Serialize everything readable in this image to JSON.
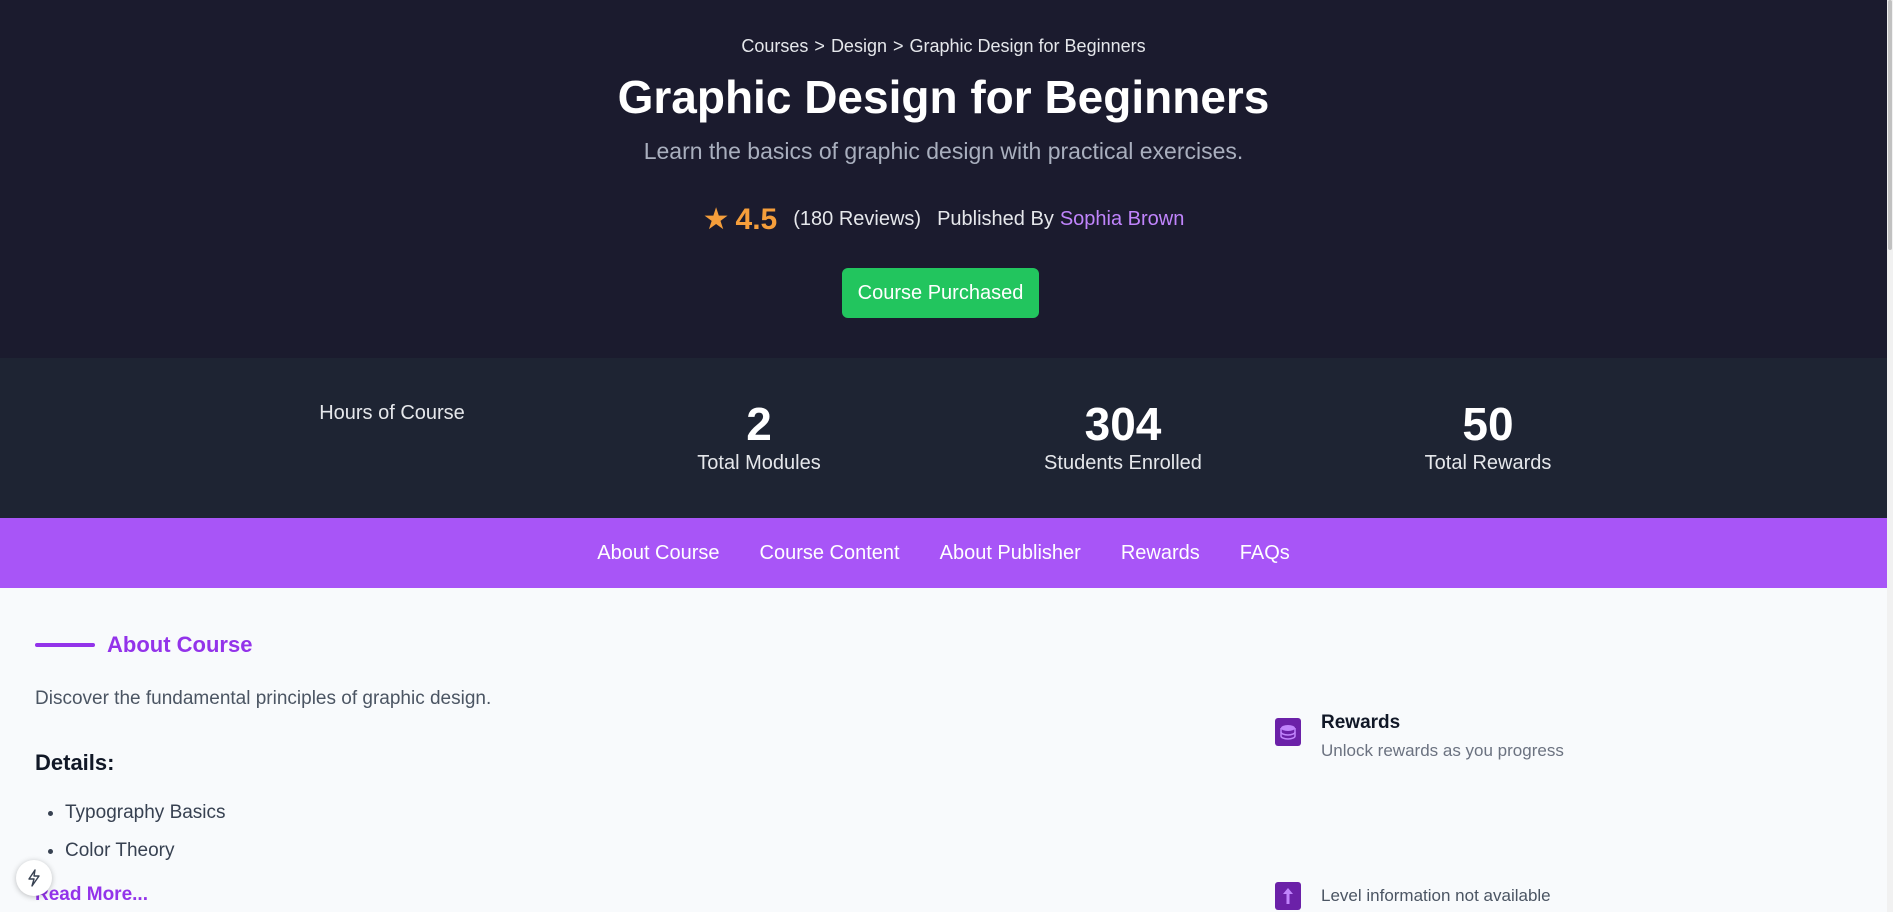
{
  "breadcrumb": {
    "items": [
      "Courses",
      "Design",
      "Graphic Design for Beginners"
    ],
    "separator": ">"
  },
  "course": {
    "title": "Graphic Design for Beginners",
    "subtitle": "Learn the basics of graphic design with practical exercises.",
    "rating": "4.5",
    "reviews": "(180 Reviews)",
    "published_by_label": "Published By",
    "author": "Sophia Brown",
    "status_button": "Course Purchased"
  },
  "stats": {
    "hours_label": "Hours of Course",
    "modules": {
      "value": "2",
      "label": "Total Modules"
    },
    "students": {
      "value": "304",
      "label": "Students Enrolled"
    },
    "rewards": {
      "value": "50",
      "label": "Total Rewards"
    }
  },
  "tabs": [
    "About Course",
    "Course Content",
    "About Publisher",
    "Rewards",
    "FAQs"
  ],
  "about": {
    "heading": "About Course",
    "description": "Discover the fundamental principles of graphic design.",
    "details_heading": "Details:",
    "details": [
      "Typography Basics",
      "Color Theory"
    ],
    "read_more": "Read More..."
  },
  "sidebar": {
    "rewards_title": "Rewards",
    "rewards_subtitle": "Unlock rewards as you progress",
    "level_text": "Level information not available"
  },
  "colors": {
    "hero_bg": "#1b1b2e",
    "stats_bg": "#1e2433",
    "accent_purple": "#a855f7",
    "success_green": "#22c55e",
    "rating_orange": "#f59e3b"
  },
  "icons": {
    "rating": "star-icon",
    "rewards": "coins-icon",
    "level": "arrow-up-icon",
    "floating": "bolt-icon"
  }
}
